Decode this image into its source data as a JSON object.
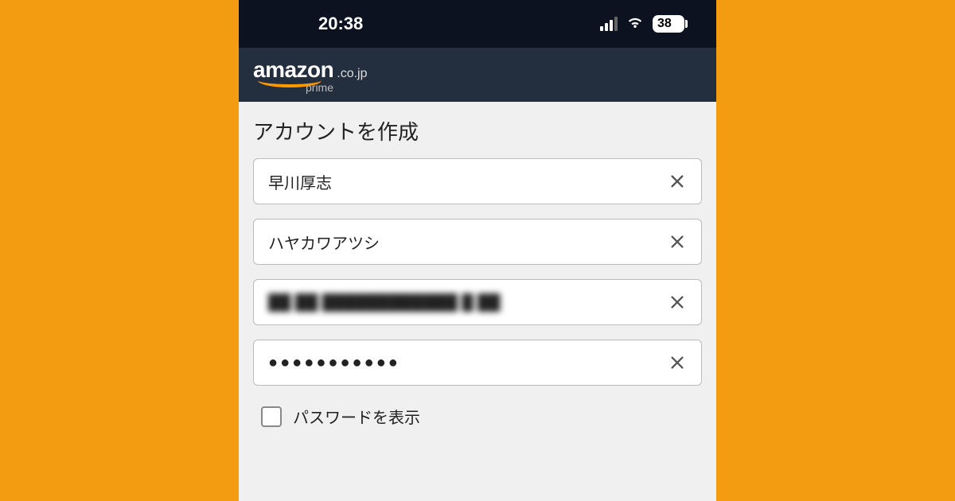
{
  "status": {
    "time": "20:38",
    "battery": "38"
  },
  "brand": {
    "name": "amazon",
    "domain": ".co.jp",
    "sub": "prime"
  },
  "form": {
    "title": "アカウントを作成",
    "name_value": "早川厚志",
    "kana_value": "ハヤカワアツシ",
    "email_value": "",
    "password_value": "●●●●●●●●●●●",
    "show_password_label": "パスワードを表示"
  }
}
